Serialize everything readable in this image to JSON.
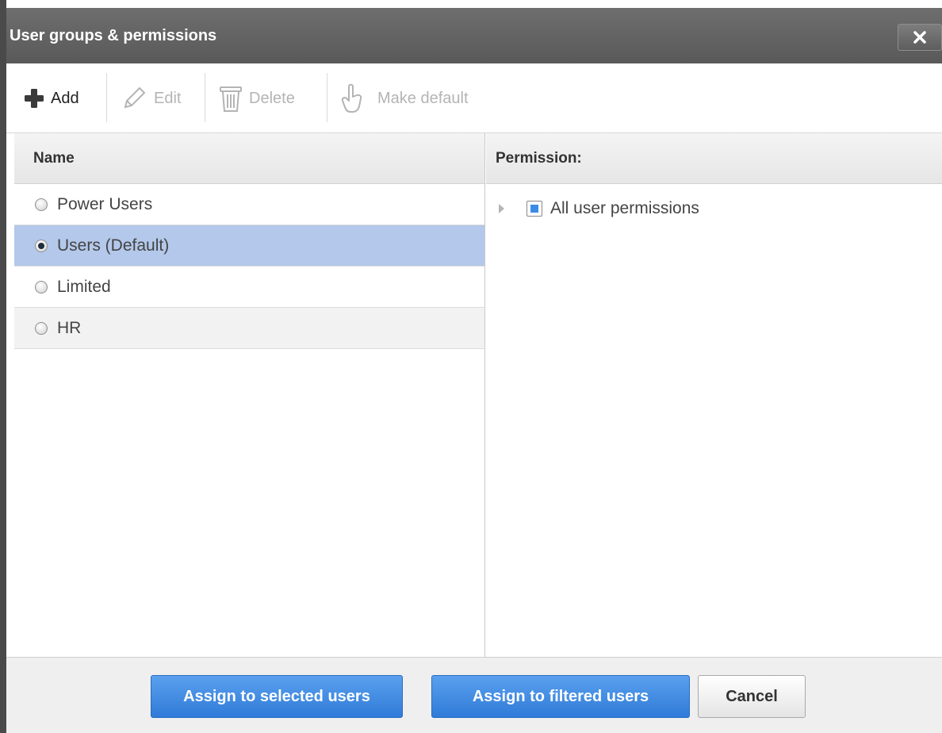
{
  "dialog": {
    "title": "User groups & permissions",
    "close_icon": "close-icon"
  },
  "toolbar": {
    "add_label": "Add",
    "edit_label": "Edit",
    "delete_label": "Delete",
    "make_default_label": "Make default"
  },
  "groups": {
    "header": "Name",
    "items": [
      {
        "label": "Power Users",
        "checked": false
      },
      {
        "label": "Users (Default)",
        "checked": true
      },
      {
        "label": "Limited",
        "checked": false
      },
      {
        "label": "HR",
        "checked": false
      }
    ]
  },
  "permissions": {
    "header": "Permission:",
    "tree": [
      {
        "label": "All user permissions",
        "expanded": false,
        "state": "partial"
      }
    ]
  },
  "footer": {
    "assign_selected_label": "Assign to selected users",
    "assign_filtered_label": "Assign to filtered users",
    "cancel_label": "Cancel"
  },
  "colors": {
    "titlebar": "#666666",
    "selection": "#b3c8ea",
    "primary_button": "#3a86e0"
  }
}
